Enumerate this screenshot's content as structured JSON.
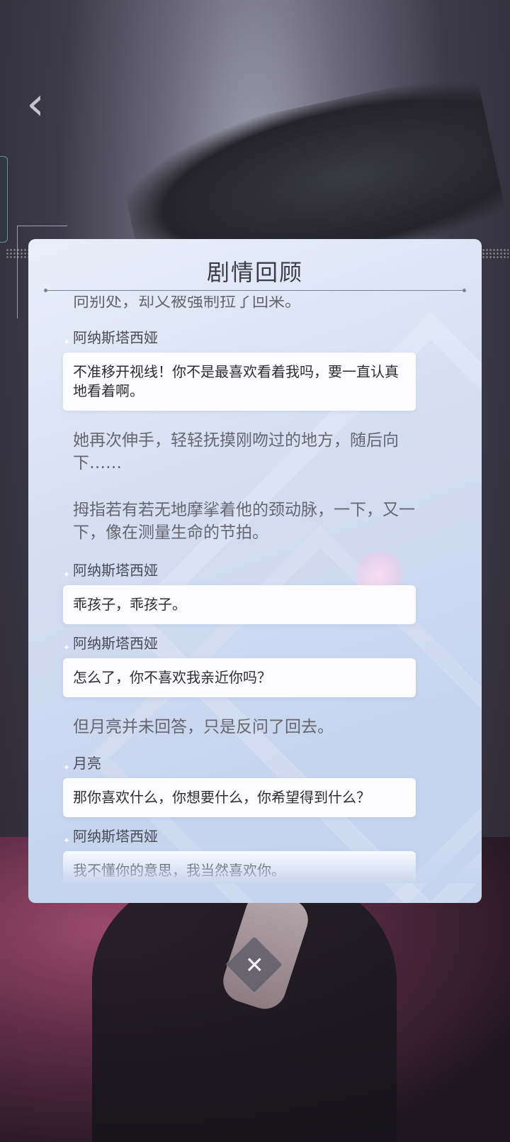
{
  "panel": {
    "title": "剧情回顾"
  },
  "log": [
    {
      "type": "narration",
      "text": "向别处，却又被强制拉了回来。"
    },
    {
      "type": "speech",
      "speaker": "阿纳斯塔西娅",
      "text": "不准移开视线！你不是最喜欢看着我吗，要一直认真地看着啊。"
    },
    {
      "type": "narration",
      "text": "她再次伸手，轻轻抚摸刚吻过的地方，随后向下……"
    },
    {
      "type": "narration",
      "text": "拇指若有若无地摩挲着他的颈动脉，一下，又一下，像在测量生命的节拍。"
    },
    {
      "type": "speech",
      "speaker": "阿纳斯塔西娅",
      "text": "乖孩子，乖孩子。"
    },
    {
      "type": "speech",
      "speaker": "阿纳斯塔西娅",
      "text": "怎么了，你不喜欢我亲近你吗？"
    },
    {
      "type": "narration",
      "text": "但月亮并未回答，只是反问了回去。"
    },
    {
      "type": "speech",
      "speaker": "月亮",
      "text": "那你喜欢什么，你想要什么，你希望得到什么？"
    },
    {
      "type": "speech",
      "speaker": "阿纳斯塔西娅",
      "text": "我不懂你的意思，我当然喜欢你。"
    }
  ],
  "close_button": {
    "symbol": "✕"
  },
  "back_button": {
    "symbol": "‹"
  }
}
